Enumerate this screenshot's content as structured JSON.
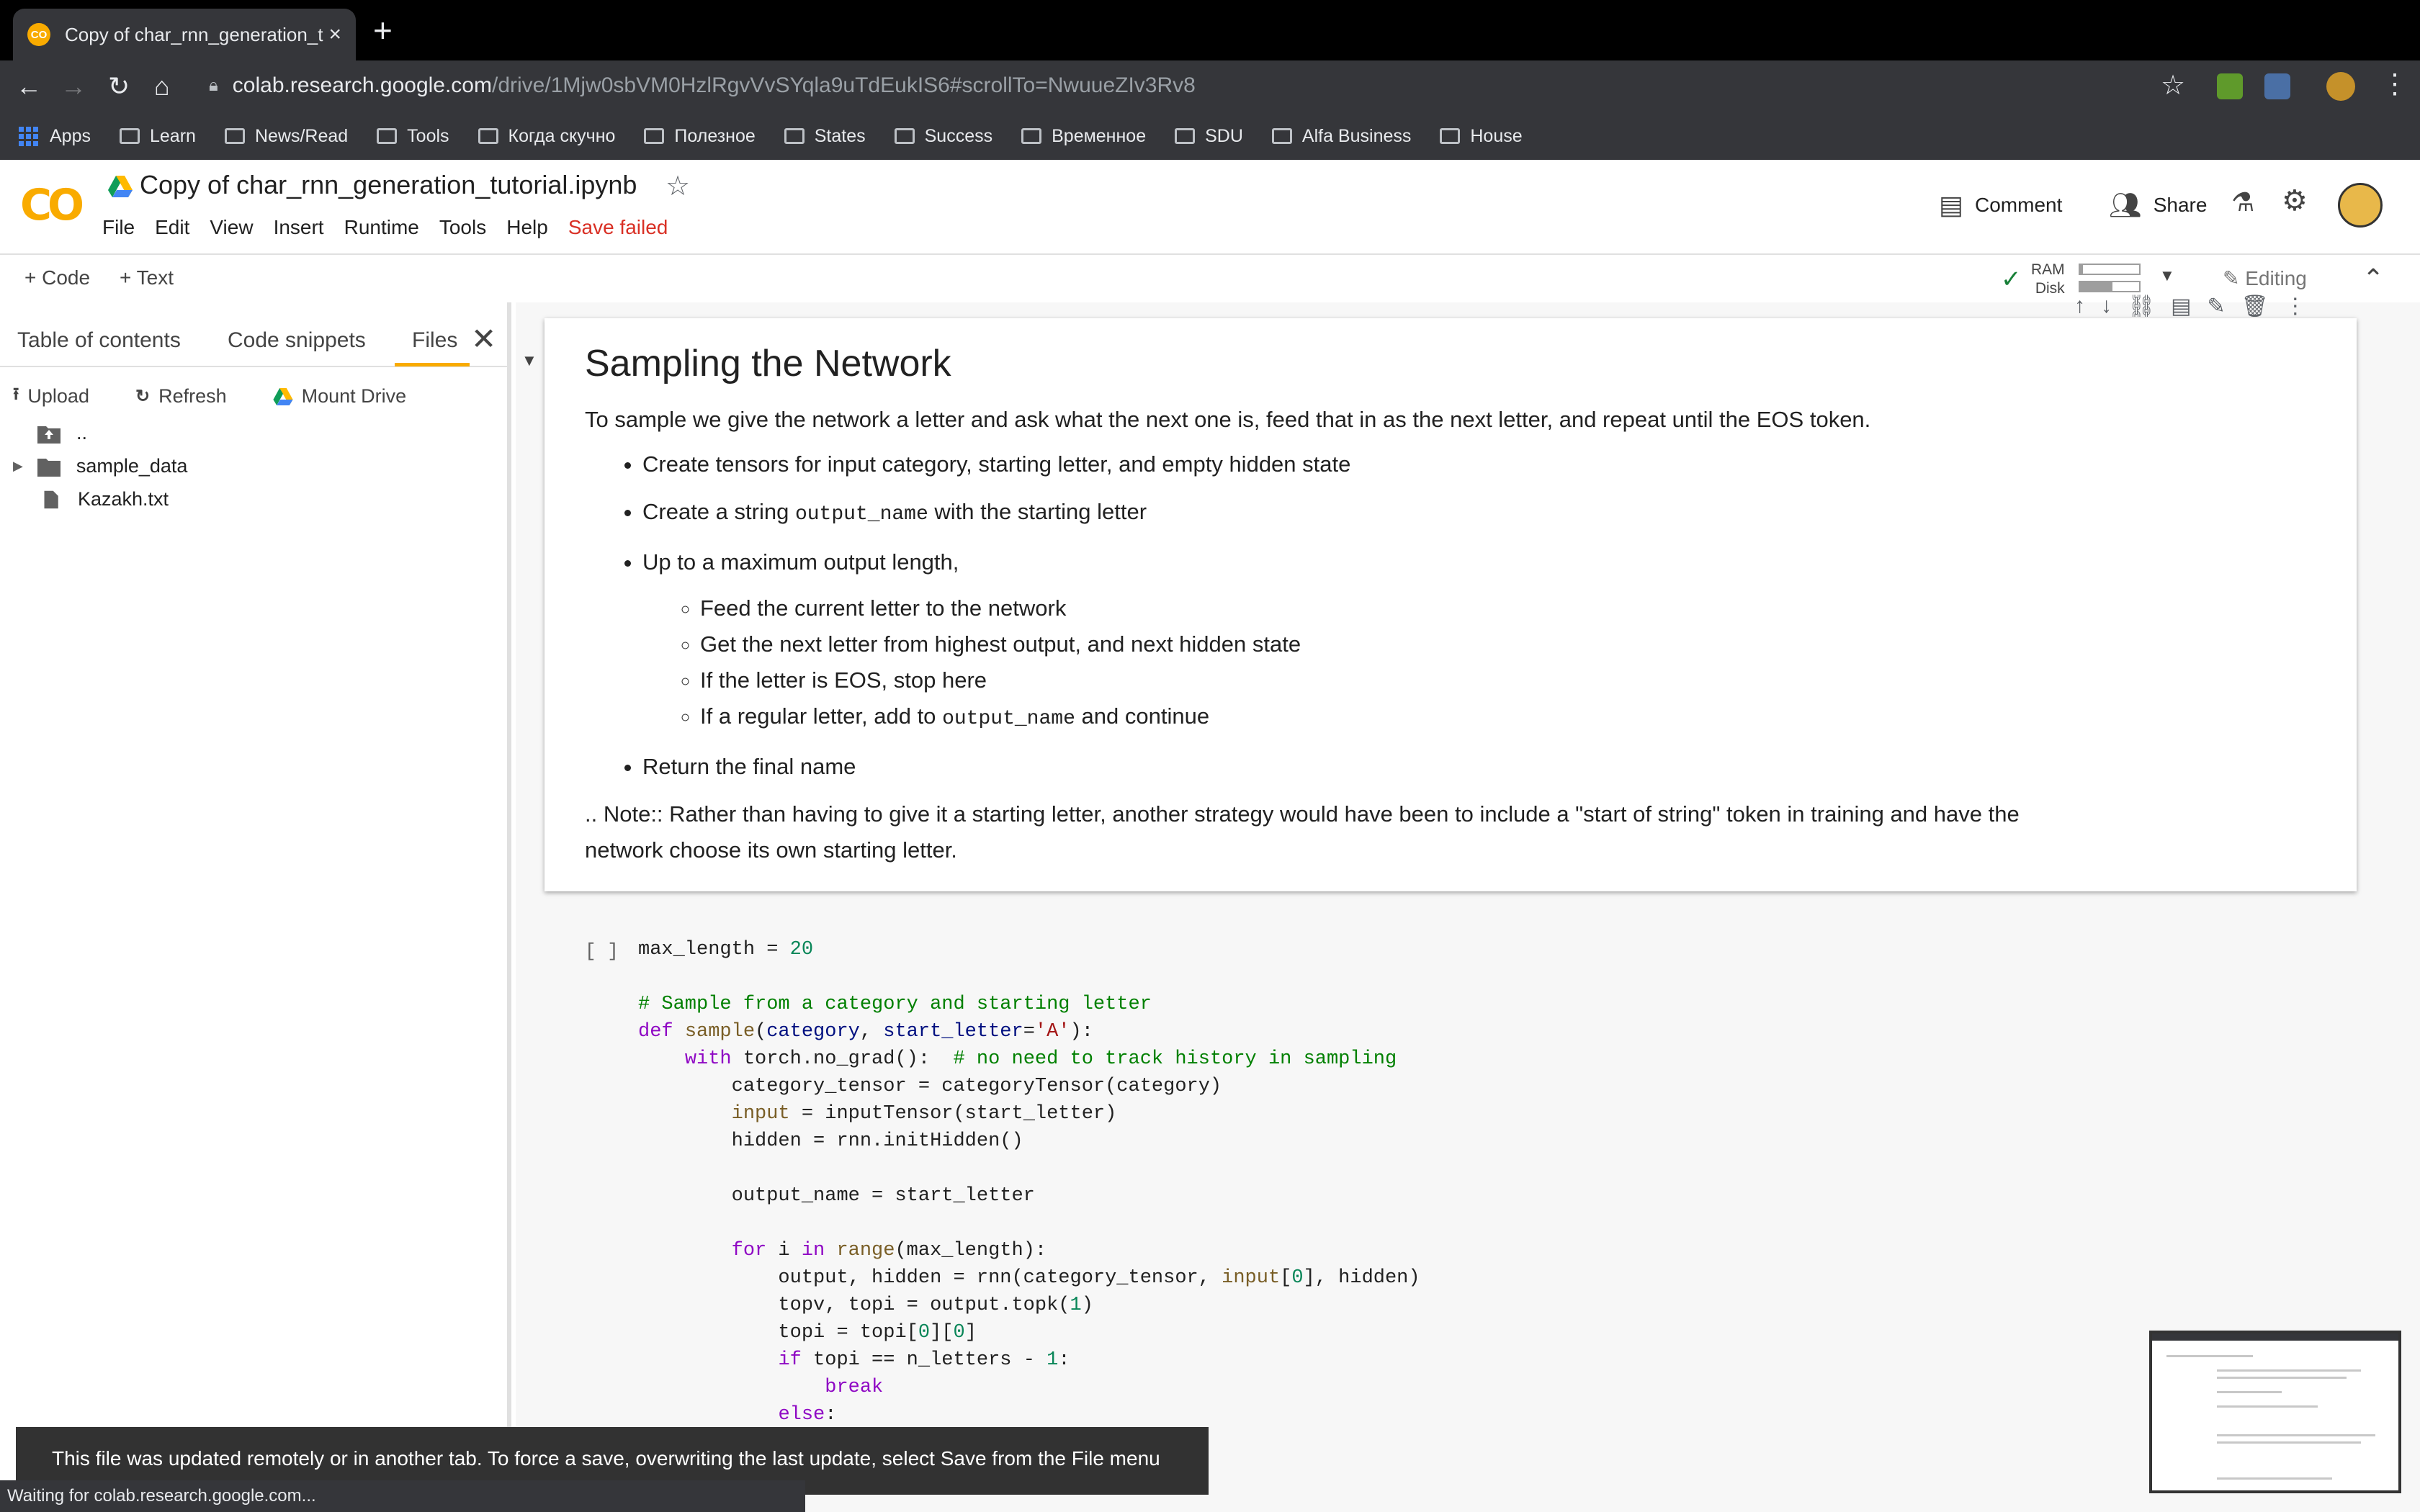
{
  "browser": {
    "tab_title": "Copy of char_rnn_generation_tutorial.ipynb - Colaboratory",
    "tab_favicon": "CO",
    "url_host": "colab.research.google.com",
    "url_path": "/drive/1Mjw0sbVM0HzlRgvVvSYqla9uTdEukIS6#scrollTo=NwuueZIv3Rv8",
    "bookmarks": [
      "Apps",
      "Learn",
      "News/Read",
      "Tools",
      "Когда скучно",
      "Полезное",
      "States",
      "Success",
      "Временное",
      "SDU",
      "Alfa Business",
      "House"
    ]
  },
  "colab": {
    "logo": "CO",
    "notebook_title": "Copy of char_rnn_generation_tutorial.ipynb",
    "menu": [
      "File",
      "Edit",
      "View",
      "Insert",
      "Runtime",
      "Tools",
      "Help"
    ],
    "save_status": "Save failed",
    "comment_label": "Comment",
    "share_label": "Share",
    "accent_color": "#f9ab00",
    "error_color": "#d93025"
  },
  "toolbar": {
    "add_code": "+ Code",
    "add_text": "+ Text",
    "ram_label": "RAM",
    "disk_label": "Disk",
    "ram_fraction": 0.05,
    "disk_fraction": 0.55,
    "editing_label": "Editing"
  },
  "sidebar": {
    "tabs": [
      "Table of contents",
      "Code snippets",
      "Files"
    ],
    "active_tab": "Files",
    "actions": {
      "upload": "Upload",
      "refresh": "Refresh",
      "mount": "Mount Drive"
    },
    "files": [
      {
        "name": "..",
        "type": "parent"
      },
      {
        "name": "sample_data",
        "type": "folder"
      },
      {
        "name": "Kazakh.txt",
        "type": "file"
      }
    ]
  },
  "text_cell": {
    "heading": "Sampling the Network",
    "intro": "To sample we give the network a letter and ask what the next one is, feed that in as the next letter, and repeat until the EOS token.",
    "bullets": {
      "b1": "Create tensors for input category, starting letter, and empty hidden state",
      "b2_pre": "Create a string",
      "b2_code": "output_name",
      "b2_post": "with the starting letter",
      "b3": "Up to a maximum output length,",
      "b3_sub1": "Feed the current letter to the network",
      "b3_sub2": "Get the next letter from highest output, and next hidden state",
      "b3_sub3": "If the letter is EOS, stop here",
      "b3_sub4_pre": "If a regular letter, add to",
      "b3_sub4_code": "output_name",
      "b3_sub4_post": "and continue",
      "b4": "Return the final name"
    },
    "note": ".. Note:: Rather than having to give it a starting letter, another strategy would have been to include a \"start of string\" token in training and have the network choose its own starting letter."
  },
  "code_cell": {
    "run_indicator": "[ ]"
  },
  "toast": {
    "message": "This file was updated remotely or in another tab. To force a save, overwriting the last update, select Save from the File menu"
  },
  "status_bar": "Waiting for colab.research.google.com..."
}
